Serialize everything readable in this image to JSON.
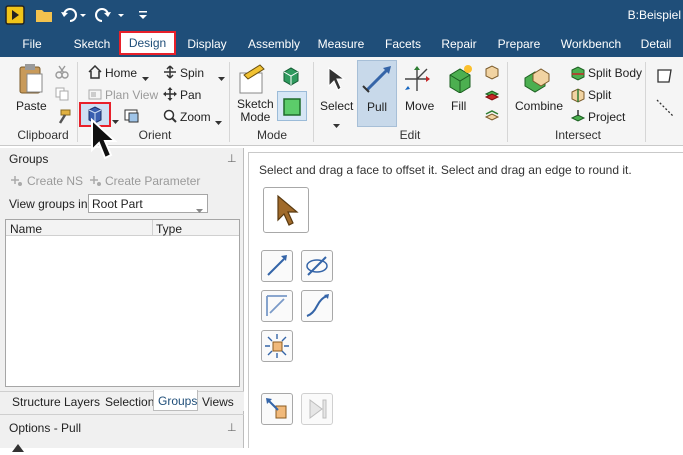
{
  "window": {
    "title": "B:Beispiel"
  },
  "tabs": [
    "File",
    "Sketch",
    "Design",
    "Display",
    "Assembly",
    "Measure",
    "Facets",
    "Repair",
    "Prepare",
    "Workbench",
    "Detail"
  ],
  "ribbon": {
    "clipboard": {
      "paste": "Paste",
      "group": "Clipboard"
    },
    "orient": {
      "home": "Home",
      "plan_view": "Plan View",
      "spin": "Spin",
      "pan": "Pan",
      "zoom": "Zoom",
      "group": "Orient"
    },
    "mode": {
      "sketch_mode": "Sketch\nMode",
      "group": "Mode"
    },
    "edit": {
      "select": "Select",
      "pull": "Pull",
      "move": "Move",
      "fill": "Fill",
      "group": "Edit"
    },
    "intersect": {
      "combine": "Combine",
      "split_body": "Split Body",
      "split": "Split",
      "project": "Project",
      "group": "Intersect"
    }
  },
  "groups_panel": {
    "title": "Groups",
    "create_ns": "Create NS",
    "create_parameter": "Create Parameter",
    "view_groups_label": "View groups in:",
    "view_groups_value": "Root Part",
    "columns": [
      "Name",
      "Type"
    ],
    "bottom_tabs": [
      "Structure",
      "Layers",
      "Selection",
      "Groups",
      "Views"
    ],
    "active_bottom_tab": "Groups"
  },
  "options_panel": {
    "title": "Options - Pull"
  },
  "canvas": {
    "hint": "Select and drag a face to offset it. Select and drag an edge to round it."
  },
  "colors": {
    "titlebar": "#1f4e79",
    "highlight": "#e8202a",
    "active_tab_text": "#1f4e79"
  }
}
